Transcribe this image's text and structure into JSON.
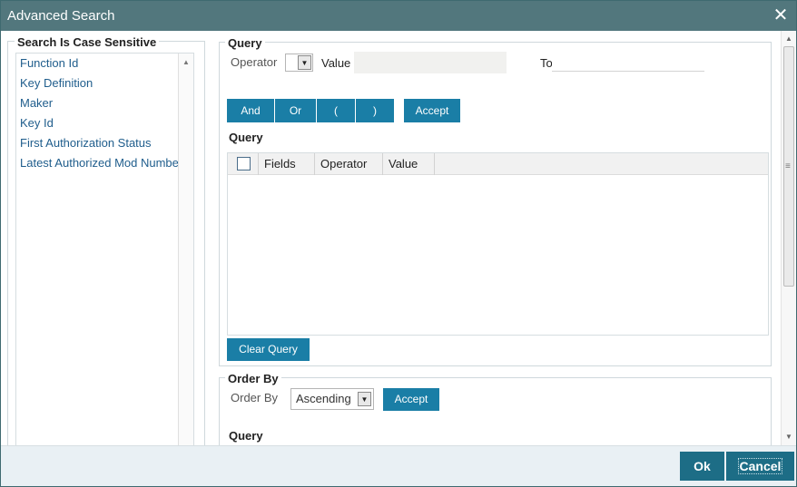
{
  "window": {
    "title": "Advanced Search",
    "close_glyph": "✕"
  },
  "left_panel": {
    "legend": "Search Is Case Sensitive",
    "items": [
      {
        "label": "Function Id"
      },
      {
        "label": "Key Definition"
      },
      {
        "label": "Maker"
      },
      {
        "label": "Key Id"
      },
      {
        "label": "First Authorization Status"
      },
      {
        "label": "Latest Authorized Mod Number"
      }
    ]
  },
  "query_section": {
    "legend": "Query",
    "operator_label": "Operator",
    "operator_value": "",
    "value_label": "Value",
    "value_input": "",
    "to_label": "To",
    "to_input": "",
    "buttons": {
      "and": "And",
      "or": "Or",
      "open_paren": "(",
      "close_paren": ")",
      "accept": "Accept"
    },
    "grid_title": "Query",
    "grid_columns": [
      "Fields",
      "Operator",
      "Value"
    ],
    "grid_rows": [],
    "clear_query_label": "Clear Query"
  },
  "order_section": {
    "legend": "Order By",
    "order_label": "Order By",
    "order_value": "Ascending",
    "accept_label": "Accept",
    "query_label": "Query"
  },
  "footer": {
    "ok_label": "Ok",
    "cancel_label": "Cancel"
  },
  "colors": {
    "titlebar": "#52777d",
    "button": "#1a7ea6",
    "footer_button": "#1d6d86",
    "link": "#1f5d8c"
  },
  "icons": {
    "close": "close-icon",
    "dropdown": "chevron-down-icon",
    "scroll_up": "scroll-up-icon",
    "scroll_down": "scroll-down-icon"
  }
}
